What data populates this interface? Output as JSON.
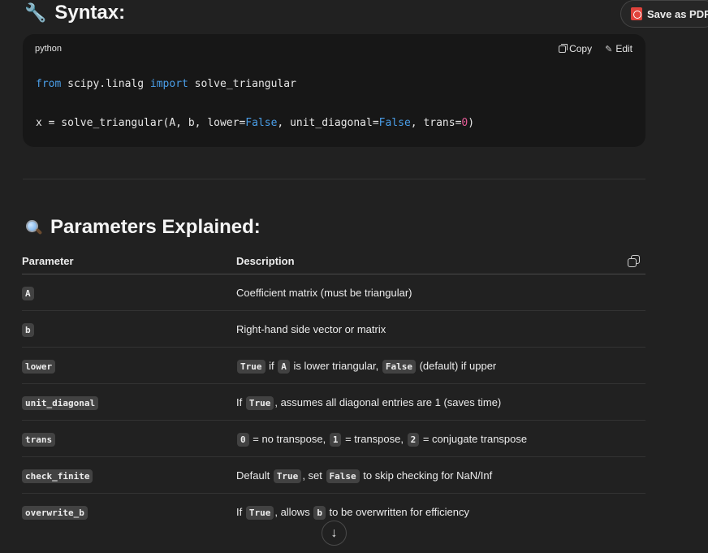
{
  "syntax_heading": {
    "emoji": "🔧",
    "text": "Syntax:"
  },
  "save_pdf": {
    "label": "Save as PDF",
    "icon": "pdf-icon"
  },
  "code_block": {
    "language": "python",
    "copy_label": "Copy",
    "edit_label": "Edit",
    "line1": {
      "kw1": "from",
      "mod": " scipy.linalg ",
      "kw2": "import",
      "rest": " solve_triangular"
    },
    "line2": {
      "p1": "x = solve_triangular(A, b, lower=",
      "v1": "False",
      "p2": ", unit_diagonal=",
      "v2": "False",
      "p3": ", trans=",
      "v3": "0",
      "p4": ")"
    }
  },
  "params_heading": {
    "emoji": "magnifier-icon",
    "text": "Parameters Explained:"
  },
  "table": {
    "headers": {
      "parameter": "Parameter",
      "description": "Description"
    },
    "rows": [
      {
        "param": "A",
        "desc": [
          {
            "t": "Coefficient matrix (must be triangular)"
          }
        ]
      },
      {
        "param": "b",
        "desc": [
          {
            "t": "Right-hand side vector or matrix"
          }
        ]
      },
      {
        "param": "lower",
        "desc": [
          {
            "c": "True"
          },
          {
            "t": " if "
          },
          {
            "c": "A"
          },
          {
            "t": " is lower triangular, "
          },
          {
            "c": "False"
          },
          {
            "t": " (default) if upper"
          }
        ]
      },
      {
        "param": "unit_diagonal",
        "desc": [
          {
            "t": "If "
          },
          {
            "c": "True"
          },
          {
            "t": ", assumes all diagonal entries are 1 (saves time)"
          }
        ]
      },
      {
        "param": "trans",
        "desc": [
          {
            "c": "0"
          },
          {
            "t": " = no transpose, "
          },
          {
            "c": "1"
          },
          {
            "t": " = transpose, "
          },
          {
            "c": "2"
          },
          {
            "t": " = conjugate transpose"
          }
        ]
      },
      {
        "param": "check_finite",
        "desc": [
          {
            "t": "Default "
          },
          {
            "c": "True"
          },
          {
            "t": ", set "
          },
          {
            "c": "False"
          },
          {
            "t": " to skip checking for NaN/Inf"
          }
        ]
      },
      {
        "param": "overwrite_b",
        "desc": [
          {
            "t": "If "
          },
          {
            "c": "True"
          },
          {
            "t": ", allows "
          },
          {
            "c": "b"
          },
          {
            "t": " to be overwritten for efficiency"
          }
        ]
      }
    ]
  },
  "scroll_button": {
    "icon": "arrow-down-icon",
    "glyph": "↓"
  }
}
